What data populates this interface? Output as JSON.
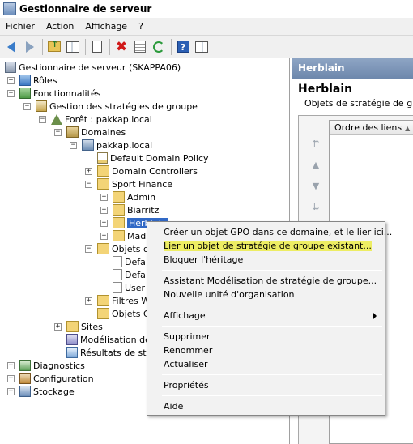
{
  "window": {
    "title": "Gestionnaire de serveur"
  },
  "menu": [
    "Fichier",
    "Action",
    "Affichage",
    "?"
  ],
  "toolbar_icons": [
    "back-icon",
    "forward-icon",
    "up-folder-icon",
    "show-hide-tree-icon",
    "copy-icon",
    "delete-icon",
    "properties-icon",
    "refresh-icon",
    "help-icon",
    "show-hide-action-pane-icon"
  ],
  "tree": {
    "root": "Gestionnaire de serveur (SKAPPA06)",
    "roles": "Rôles",
    "features": "Fonctionnalités",
    "gpm": "Gestion des stratégies de groupe",
    "forest": "Forêt : pakkap.local",
    "domains": "Domaines",
    "domain": "pakkap.local",
    "ddp": "Default Domain Policy",
    "dc": "Domain Controllers",
    "sport": "Sport Finance",
    "admin": "Admin",
    "biarritz": "Biarritz",
    "herblain": "Herblain",
    "madrid": "Madr",
    "gpo_objects": "Objets d",
    "defa1": "Defa",
    "defa2": "Defa",
    "user": "User",
    "wmi": "Filtres W",
    "gpo_starter": "Objets G",
    "sites": "Sites",
    "modeling": "Modélisation de s",
    "results": "Résultats de stra",
    "diagnostics": "Diagnostics",
    "configuration": "Configuration",
    "storage": "Stockage"
  },
  "right_pane": {
    "header": "Herblain",
    "title": "Herblain",
    "subtitle": "Objets de stratégie de groupe",
    "column": "Ordre des liens"
  },
  "context_menu": {
    "create_gpo": "Créer un objet GPO dans ce domaine, et le lier ici...",
    "link_gpo": "Lier un objet de stratégie de groupe existant...",
    "block_inheritance": "Bloquer l'héritage",
    "modeling_wizard": "Assistant Modélisation de stratégie de groupe...",
    "new_ou": "Nouvelle unité d'organisation",
    "view": "Affichage",
    "delete": "Supprimer",
    "rename": "Renommer",
    "refresh": "Actualiser",
    "properties": "Propriétés",
    "help": "Aide"
  },
  "colors": {
    "highlight": "#eded63",
    "selection": "#3169c6",
    "pane_header": "#7d95b8"
  }
}
